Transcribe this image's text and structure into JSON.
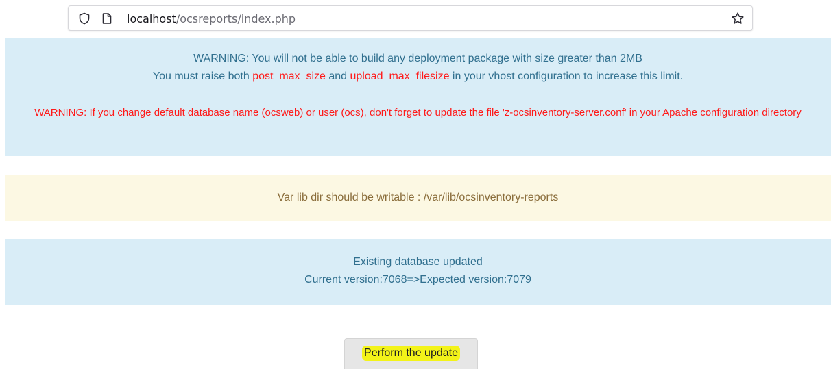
{
  "browser": {
    "url_host": "localhost",
    "url_path": "/ocsreports/index.php",
    "icons": [
      "shield-icon",
      "page-icon",
      "star-icon"
    ]
  },
  "alerts": {
    "deployment": {
      "line1": "WARNING: You will not be able to build any deployment package with size greater than 2MB",
      "line2_prefix": "You must raise both ",
      "line2_param1": "post_max_size",
      "line2_middle": " and ",
      "line2_param2": "upload_max_filesize",
      "line2_suffix": " in your vhost configuration to increase this limit.",
      "database_warning": "WARNING: If you change default database name (ocsweb) or user (ocs), don't forget to update the file 'z-ocsinventory-server.conf' in your Apache configuration directory"
    },
    "var_lib": {
      "text": "Var lib dir should be writable : /var/lib/ocsinventory-reports"
    },
    "database": {
      "line1": "Existing database updated",
      "line2": "Current version:7068=>Expected version:7079"
    }
  },
  "update_button": {
    "label": "Perform the update"
  },
  "colors": {
    "info_background": "#d9edf7",
    "info_text": "#31708f",
    "warning_background": "#fcf8e3",
    "warning_text": "#8a6d3b",
    "param_red": "#ff1a1a",
    "button_highlight": "#f3f319"
  }
}
